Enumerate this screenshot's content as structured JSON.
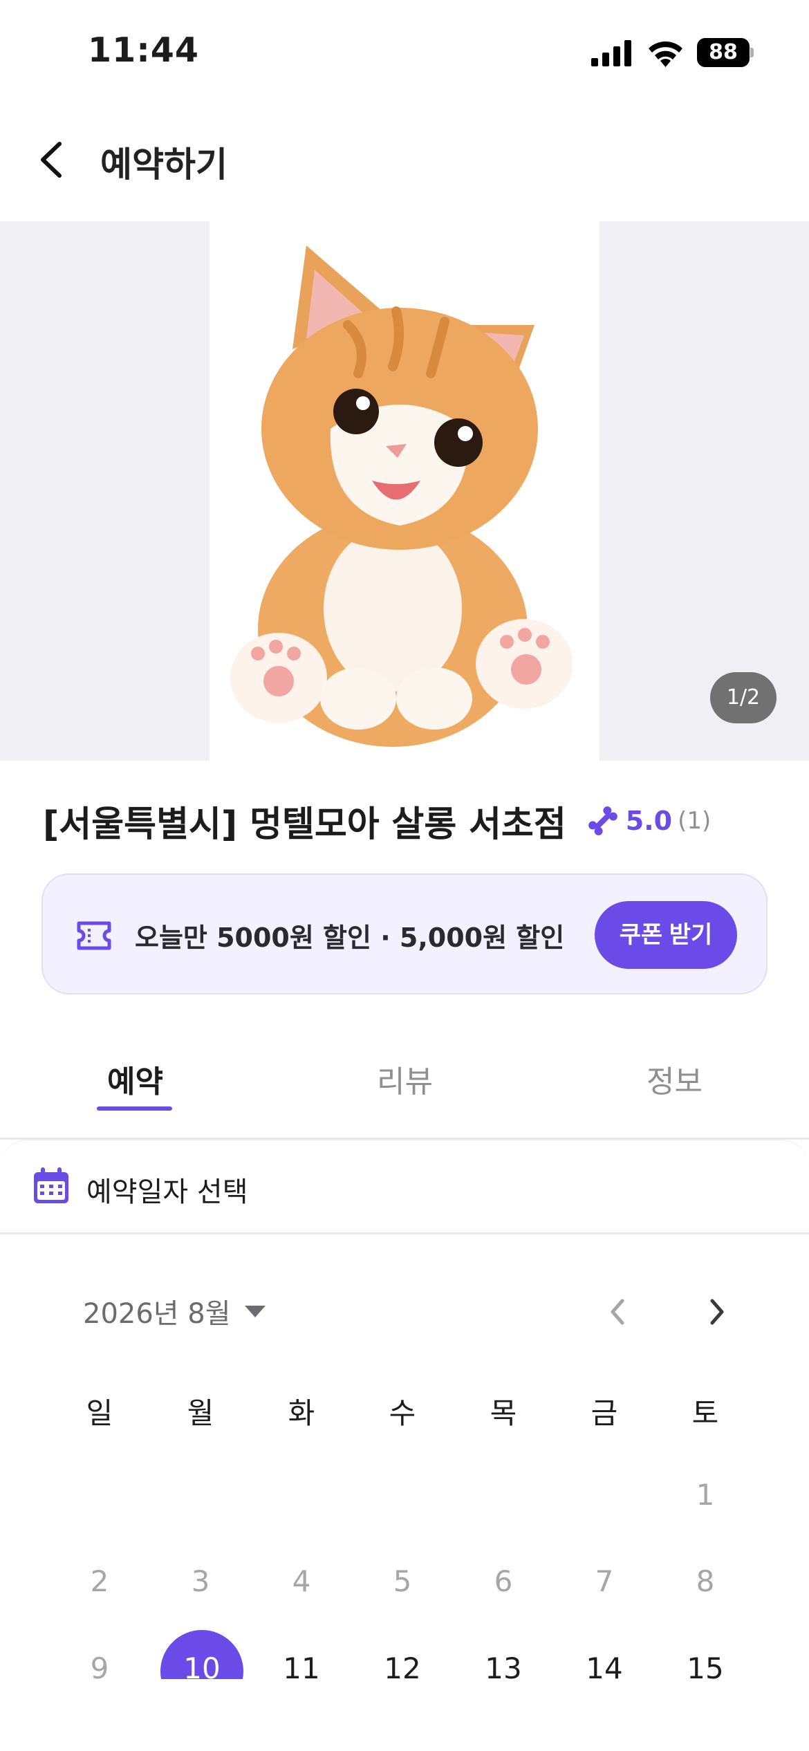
{
  "status_bar": {
    "time": "11:44",
    "battery": "88"
  },
  "header": {
    "title": "예약하기"
  },
  "hero": {
    "pager": "1/2"
  },
  "shop": {
    "name": "[서울특별시] 멍텔모아 살롱 서초점",
    "rating": "5.0",
    "rating_count": "(1)"
  },
  "coupon": {
    "text": "오늘만 5000원 할인 · 5,000원 할인",
    "button": "쿠폰 받기"
  },
  "tabs": [
    {
      "label": "예약"
    },
    {
      "label": "리뷰"
    },
    {
      "label": "정보"
    }
  ],
  "date_section": {
    "title": "예약일자 선택"
  },
  "calendar": {
    "month": "2026년 8월",
    "weekdays": [
      "일",
      "월",
      "화",
      "수",
      "목",
      "금",
      "토"
    ],
    "row1": [
      "1"
    ],
    "row2": [
      "2",
      "3",
      "4",
      "5",
      "6",
      "7",
      "8"
    ],
    "row3": [
      "9",
      "10",
      "11",
      "12",
      "13",
      "14",
      "15"
    ],
    "selected_day": "10"
  },
  "colors": {
    "accent": "#6a4be8",
    "disabled_day": "#a5a5aa"
  }
}
